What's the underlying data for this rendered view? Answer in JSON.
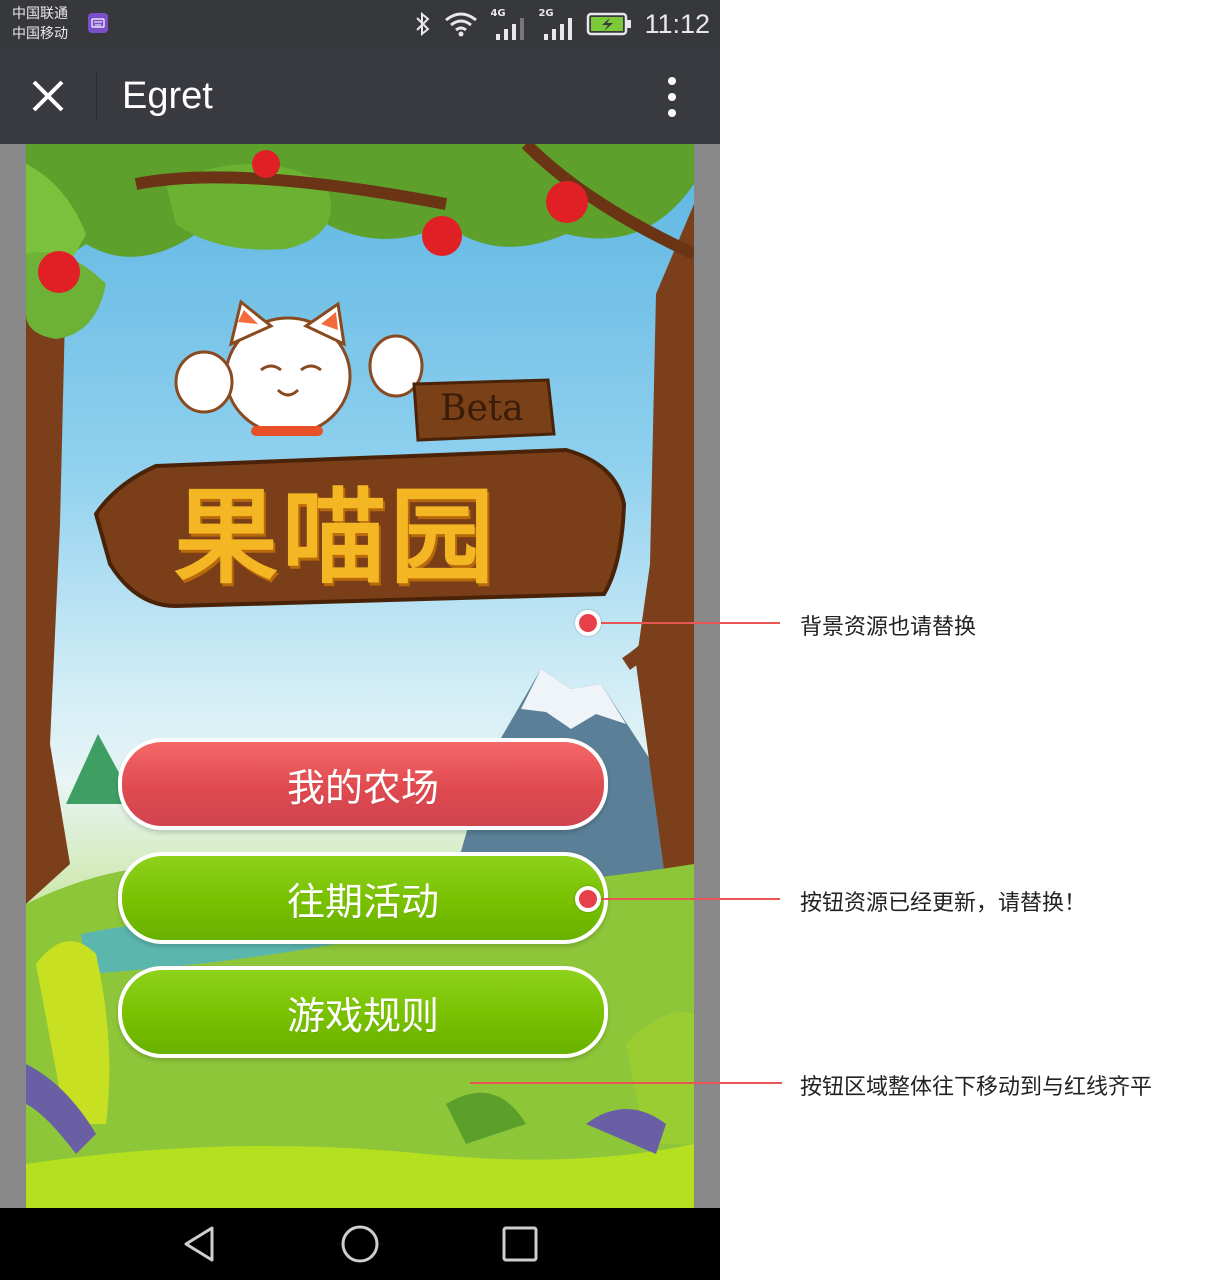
{
  "status_bar": {
    "carrier_1": "中国联通",
    "carrier_2": "中国移动",
    "network_1": "4G",
    "network_2": "2G",
    "time": "11:12"
  },
  "title_bar": {
    "title": "Egret",
    "close_icon": "close-icon",
    "more_icon": "more-vertical-icon"
  },
  "game": {
    "logo_text": "果喵园",
    "badge_text": "Beta",
    "buttons": [
      {
        "label": "我的农场",
        "color": "#e0505a"
      },
      {
        "label": "往期活动",
        "color": "#7ac000"
      },
      {
        "label": "游戏规则",
        "color": "#7ac000"
      }
    ]
  },
  "nav_bar": {
    "back_icon": "back-triangle-icon",
    "home_icon": "home-circle-icon",
    "recents_icon": "recents-square-icon"
  },
  "annotations": [
    {
      "text": "背景资源也请替换"
    },
    {
      "text": "按钮资源已经更新，请替换！"
    },
    {
      "text": "按钮区域整体往下移动到与红线齐平"
    }
  ],
  "colors": {
    "status_bar": "#37383c",
    "title_bar": "#393a3f",
    "annotation_line": "#e85555"
  }
}
